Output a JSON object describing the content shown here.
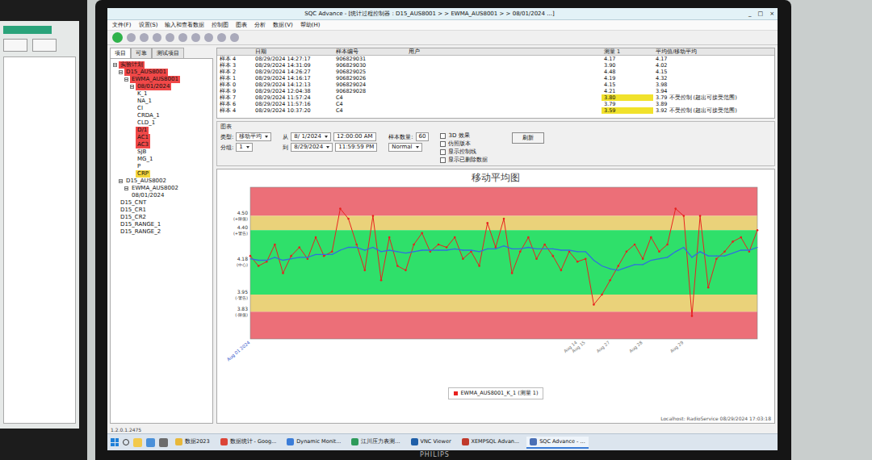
{
  "window": {
    "title": "SQC Advance - [统计过程控制器 : D15_AUS8001 > > EWMA_AUS8001 > > 08/01/2024  ...]",
    "controls": [
      "_",
      "□",
      "×"
    ]
  },
  "menu": [
    "文件(F)",
    "设置(S)",
    "输入和查看数据",
    "控制图",
    "图表",
    "分析",
    "数据(V)",
    "帮助(H)"
  ],
  "left_tabs": [
    {
      "label": "项目",
      "selected": true
    },
    {
      "label": "可靠",
      "selected": false
    },
    {
      "label": "测试项目",
      "selected": false
    }
  ],
  "tree": [
    {
      "label": "实验计划",
      "level": 0,
      "expanded": true,
      "color": "#f04848"
    },
    {
      "label": "D15_AUS8001",
      "level": 1,
      "expanded": true,
      "color": "#f04848"
    },
    {
      "label": "EWMA_AUS8001",
      "level": 2,
      "expanded": true,
      "color": "#f04848"
    },
    {
      "label": "08/01/2024",
      "level": 3,
      "expanded": true,
      "color": "#f04848"
    },
    {
      "label": "K_1",
      "level": 4,
      "expanded": false,
      "color": "#ffffff"
    },
    {
      "label": "NA_1",
      "level": 4,
      "expanded": false,
      "color": "#ffffff"
    },
    {
      "label": "CI",
      "level": 4,
      "expanded": false,
      "color": "#ffffff"
    },
    {
      "label": "CRDA_1",
      "level": 4,
      "expanded": false,
      "color": "#ffffff"
    },
    {
      "label": "CLD_1",
      "level": 4,
      "expanded": false,
      "color": "#ffffff"
    },
    {
      "label": "D/1",
      "level": 4,
      "expanded": false,
      "color": "#f04848"
    },
    {
      "label": "AC1",
      "level": 4,
      "expanded": false,
      "color": "#f04848"
    },
    {
      "label": "AC3",
      "level": 4,
      "expanded": false,
      "color": "#f04848"
    },
    {
      "label": "SJB",
      "level": 4,
      "expanded": false,
      "color": "#ffffff"
    },
    {
      "label": "MG_1",
      "level": 4,
      "expanded": false,
      "color": "#ffffff"
    },
    {
      "label": "P",
      "level": 4,
      "expanded": false,
      "color": "#ffffff"
    },
    {
      "label": "CRP",
      "level": 4,
      "expanded": false,
      "color": "#f3d53a"
    },
    {
      "label": "D15_AUS8002",
      "level": 1,
      "expanded": true,
      "color": "#ffffff"
    },
    {
      "label": "EWMA_AUS8002",
      "level": 2,
      "expanded": true,
      "color": "#ffffff"
    },
    {
      "label": "08/01/2024",
      "level": 3,
      "expanded": false,
      "color": "#ffffff"
    },
    {
      "label": "D15_CNT",
      "level": 1,
      "expanded": false,
      "color": "#ffffff"
    },
    {
      "label": "D15_CR1",
      "level": 1,
      "expanded": false,
      "color": "#ffffff"
    },
    {
      "label": "D15_CR2",
      "level": 1,
      "expanded": false,
      "color": "#ffffff"
    },
    {
      "label": "D15_RANGE_1",
      "level": 1,
      "expanded": false,
      "color": "#ffffff"
    },
    {
      "label": "D15_RANGE_2",
      "level": 1,
      "expanded": false,
      "color": "#ffffff"
    }
  ],
  "table": {
    "columns": [
      "",
      "日期",
      "样本编号",
      "用户",
      "测量 1",
      "平均值/移动平均"
    ],
    "rows": [
      {
        "cells": [
          "样本 4",
          "08/29/2024 14:27:17",
          "906829031",
          "",
          "4.17",
          "4.17"
        ],
        "flagged": false
      },
      {
        "cells": [
          "样本 3",
          "08/29/2024 14:31:09",
          "906829030",
          "",
          "3.90",
          "4.02"
        ],
        "flagged": false
      },
      {
        "cells": [
          "样本 2",
          "08/29/2024 14:26:27",
          "906829025",
          "",
          "4.48",
          "4.15"
        ],
        "flagged": false
      },
      {
        "cells": [
          "样本 1",
          "08/29/2024 14:16:17",
          "906829026",
          "",
          "4.19",
          "4.32"
        ],
        "flagged": false
      },
      {
        "cells": [
          "样本 0",
          "08/29/2024 14:12:13",
          "906829024",
          "",
          "4.15",
          "3.98"
        ],
        "flagged": false
      },
      {
        "cells": [
          "样本 9",
          "08/29/2024 12:04:38",
          "906829028",
          "",
          "4.21",
          "3.94"
        ],
        "flagged": false
      },
      {
        "cells": [
          "样本 7",
          "08/29/2024 11:57:24",
          "C4",
          "",
          "3.80",
          "3.79 不受控制 (超出可接受范围)"
        ],
        "flagged": true
      },
      {
        "cells": [
          "样本 6",
          "08/29/2024 11:57:16",
          "C4",
          "",
          "3.79",
          "3.89"
        ],
        "flagged": false
      },
      {
        "cells": [
          "样本 4",
          "08/29/2024 10:37:20",
          "C4",
          "",
          "3.59",
          "3.92 不受控制 (超出可接受范围)"
        ],
        "flagged": true
      }
    ]
  },
  "filters": {
    "heading": "图表",
    "type_label": "类型:",
    "type_value": "移动平均",
    "group_label": "分组:",
    "group_value": "1",
    "from_label": "从",
    "from_date": "8/ 1/2024",
    "from_time": "12:00:00 AM",
    "to_label": "到",
    "to_date": "8/29/2024",
    "to_time": "11:59:59 PM",
    "count_label": "样本数量:",
    "count_value": "60",
    "theme_value": "Normal",
    "checkboxes": [
      {
        "label": "3D 效果",
        "checked": false
      },
      {
        "label": "仿照版本",
        "checked": false
      },
      {
        "label": "显示控制线",
        "checked": false
      },
      {
        "label": "显示已删除数据",
        "checked": false
      }
    ],
    "button": "刷新"
  },
  "chart": {
    "title": "移动平均图",
    "axis": {
      "min": 3.64,
      "max": 4.7
    },
    "zones": [
      {
        "from": 4.5,
        "to": 4.7,
        "color": "#ec6f78"
      },
      {
        "from": 4.4,
        "to": 4.5,
        "color": "#ead27a"
      },
      {
        "from": 3.95,
        "to": 4.4,
        "color": "#2fe06a"
      },
      {
        "from": 3.83,
        "to": 3.95,
        "color": "#ead27a"
      },
      {
        "from": 3.64,
        "to": 3.83,
        "color": "#ec6f78"
      }
    ],
    "y_ticks": [
      {
        "value": 4.5,
        "label": "4.50",
        "note": "(+限值)"
      },
      {
        "value": 4.4,
        "label": "4.40",
        "note": "(+警告)"
      },
      {
        "value": 4.18,
        "label": "4.18",
        "note": "(中心)"
      },
      {
        "value": 3.95,
        "label": "3.95",
        "note": "(-警告)"
      },
      {
        "value": 3.83,
        "label": "3.83",
        "note": "(-限值)"
      }
    ],
    "x_labels": [
      {
        "index": 0,
        "label": "Aug 01 2024",
        "color": "#3355cc"
      },
      {
        "index": 40,
        "label": "Aug 14",
        "color": "#777777"
      },
      {
        "index": 41,
        "label": "Aug 15",
        "color": "#777777"
      },
      {
        "index": 44,
        "label": "Aug 27",
        "color": "#777777"
      },
      {
        "index": 48,
        "label": "Aug 28",
        "color": "#777777"
      },
      {
        "index": 53,
        "label": "Aug 29",
        "color": "#777777"
      }
    ],
    "series": [
      {
        "name": "raw",
        "color": "#e8211f",
        "markers": true,
        "values": [
          4.22,
          4.15,
          4.18,
          4.3,
          4.1,
          4.22,
          4.28,
          4.2,
          4.35,
          4.22,
          4.25,
          4.55,
          4.48,
          4.3,
          4.12,
          4.5,
          4.05,
          4.35,
          4.15,
          4.12,
          4.3,
          4.38,
          4.25,
          4.3,
          4.28,
          4.35,
          4.2,
          4.25,
          4.15,
          4.45,
          4.28,
          4.48,
          4.1,
          4.25,
          4.35,
          4.2,
          4.3,
          4.22,
          4.12,
          4.25,
          4.18,
          4.2,
          3.88,
          3.95,
          4.05,
          4.15,
          4.25,
          4.3,
          4.2,
          4.35,
          4.25,
          4.3,
          4.55,
          4.5,
          3.8,
          4.5,
          4.0,
          4.2,
          4.25,
          4.32,
          4.35,
          4.25,
          4.4
        ]
      },
      {
        "name": "ewma",
        "color": "#2f6fe0",
        "markers": false,
        "values": [
          4.2,
          4.19,
          4.19,
          4.21,
          4.19,
          4.2,
          4.21,
          4.21,
          4.23,
          4.23,
          4.23,
          4.26,
          4.28,
          4.28,
          4.26,
          4.28,
          4.25,
          4.26,
          4.25,
          4.24,
          4.25,
          4.26,
          4.26,
          4.26,
          4.26,
          4.27,
          4.26,
          4.26,
          4.25,
          4.27,
          4.27,
          4.29,
          4.27,
          4.27,
          4.28,
          4.27,
          4.27,
          4.27,
          4.26,
          4.26,
          4.25,
          4.25,
          4.19,
          4.15,
          4.13,
          4.12,
          4.14,
          4.16,
          4.16,
          4.19,
          4.2,
          4.21,
          4.25,
          4.28,
          4.21,
          4.25,
          4.22,
          4.22,
          4.22,
          4.24,
          4.26,
          4.26,
          4.28
        ]
      }
    ],
    "legend": {
      "label": "EWMA_AUS8001_K_1 (测量 1)",
      "color": "#e8211f"
    },
    "status": "Localhost: RadioService  08/29/2024 17:03:18"
  },
  "status_bar": {
    "left": "1.2.0.1.2475"
  },
  "taskbar": [
    {
      "label": "数据2023",
      "active": false,
      "color": "#e8b83a"
    },
    {
      "label": "数据统计 - Goog...",
      "active": false,
      "color": "#db4437"
    },
    {
      "label": "Dynamic Monit...",
      "active": false,
      "color": "#3b7dd8"
    },
    {
      "label": "江川压力表测...",
      "active": false,
      "color": "#2d9a5a"
    },
    {
      "label": "VNC Viewer",
      "active": false,
      "color": "#1f5fa8"
    },
    {
      "label": "XEMPSQL Advan...",
      "active": false,
      "color": "#c0392b"
    },
    {
      "label": "SQC Advance - ...",
      "active": true,
      "color": "#4a6fb5"
    }
  ],
  "monitor": {
    "brand": "PHILIPS"
  }
}
